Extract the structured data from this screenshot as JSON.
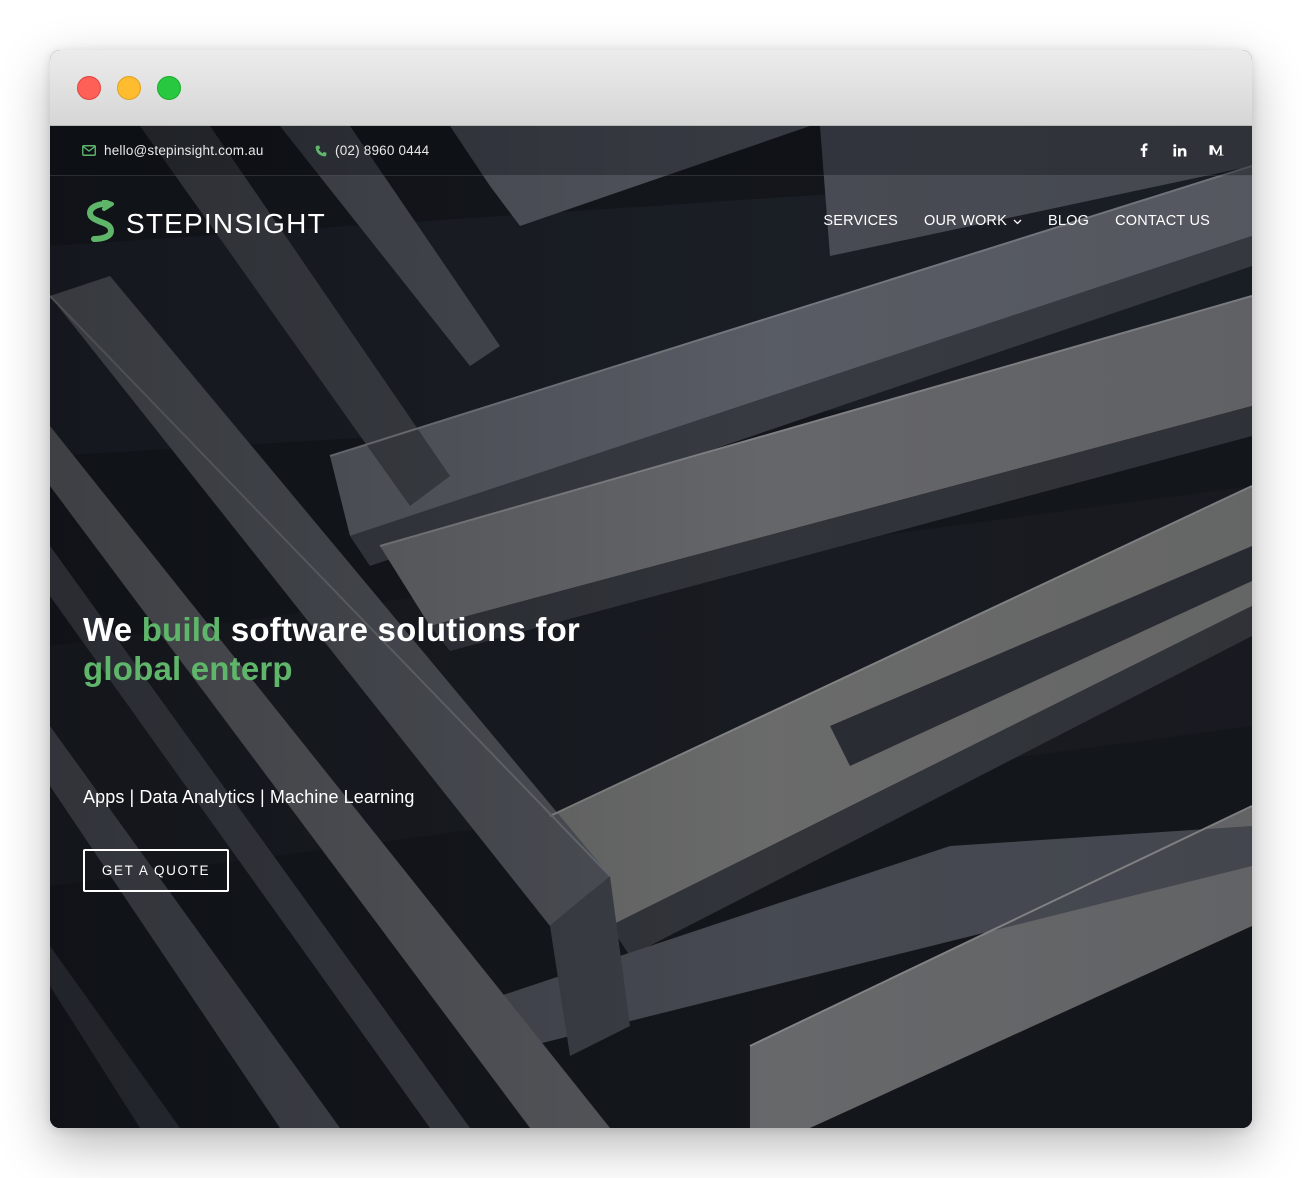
{
  "topbar": {
    "email": "hello@stepinsight.com.au",
    "phone": "(02) 8960 0444",
    "social": [
      "facebook-icon",
      "linkedin-icon",
      "medium-icon"
    ]
  },
  "header": {
    "logo_text": "STEPINSIGHT",
    "nav": [
      {
        "label": "SERVICES"
      },
      {
        "label": "OUR WORK",
        "has_dropdown": true
      },
      {
        "label": "BLOG"
      },
      {
        "label": "CONTACT US"
      }
    ]
  },
  "hero": {
    "title_part1": "We ",
    "title_accent1": "build",
    "title_part2": " software solutions for",
    "title_accent2": "global enterp",
    "subtitle": "Apps | Data Analytics | Machine Learning",
    "cta_label": "GET A QUOTE"
  },
  "colors": {
    "accent": "#5fb56a",
    "text": "#ffffff",
    "background": "#16191f"
  }
}
